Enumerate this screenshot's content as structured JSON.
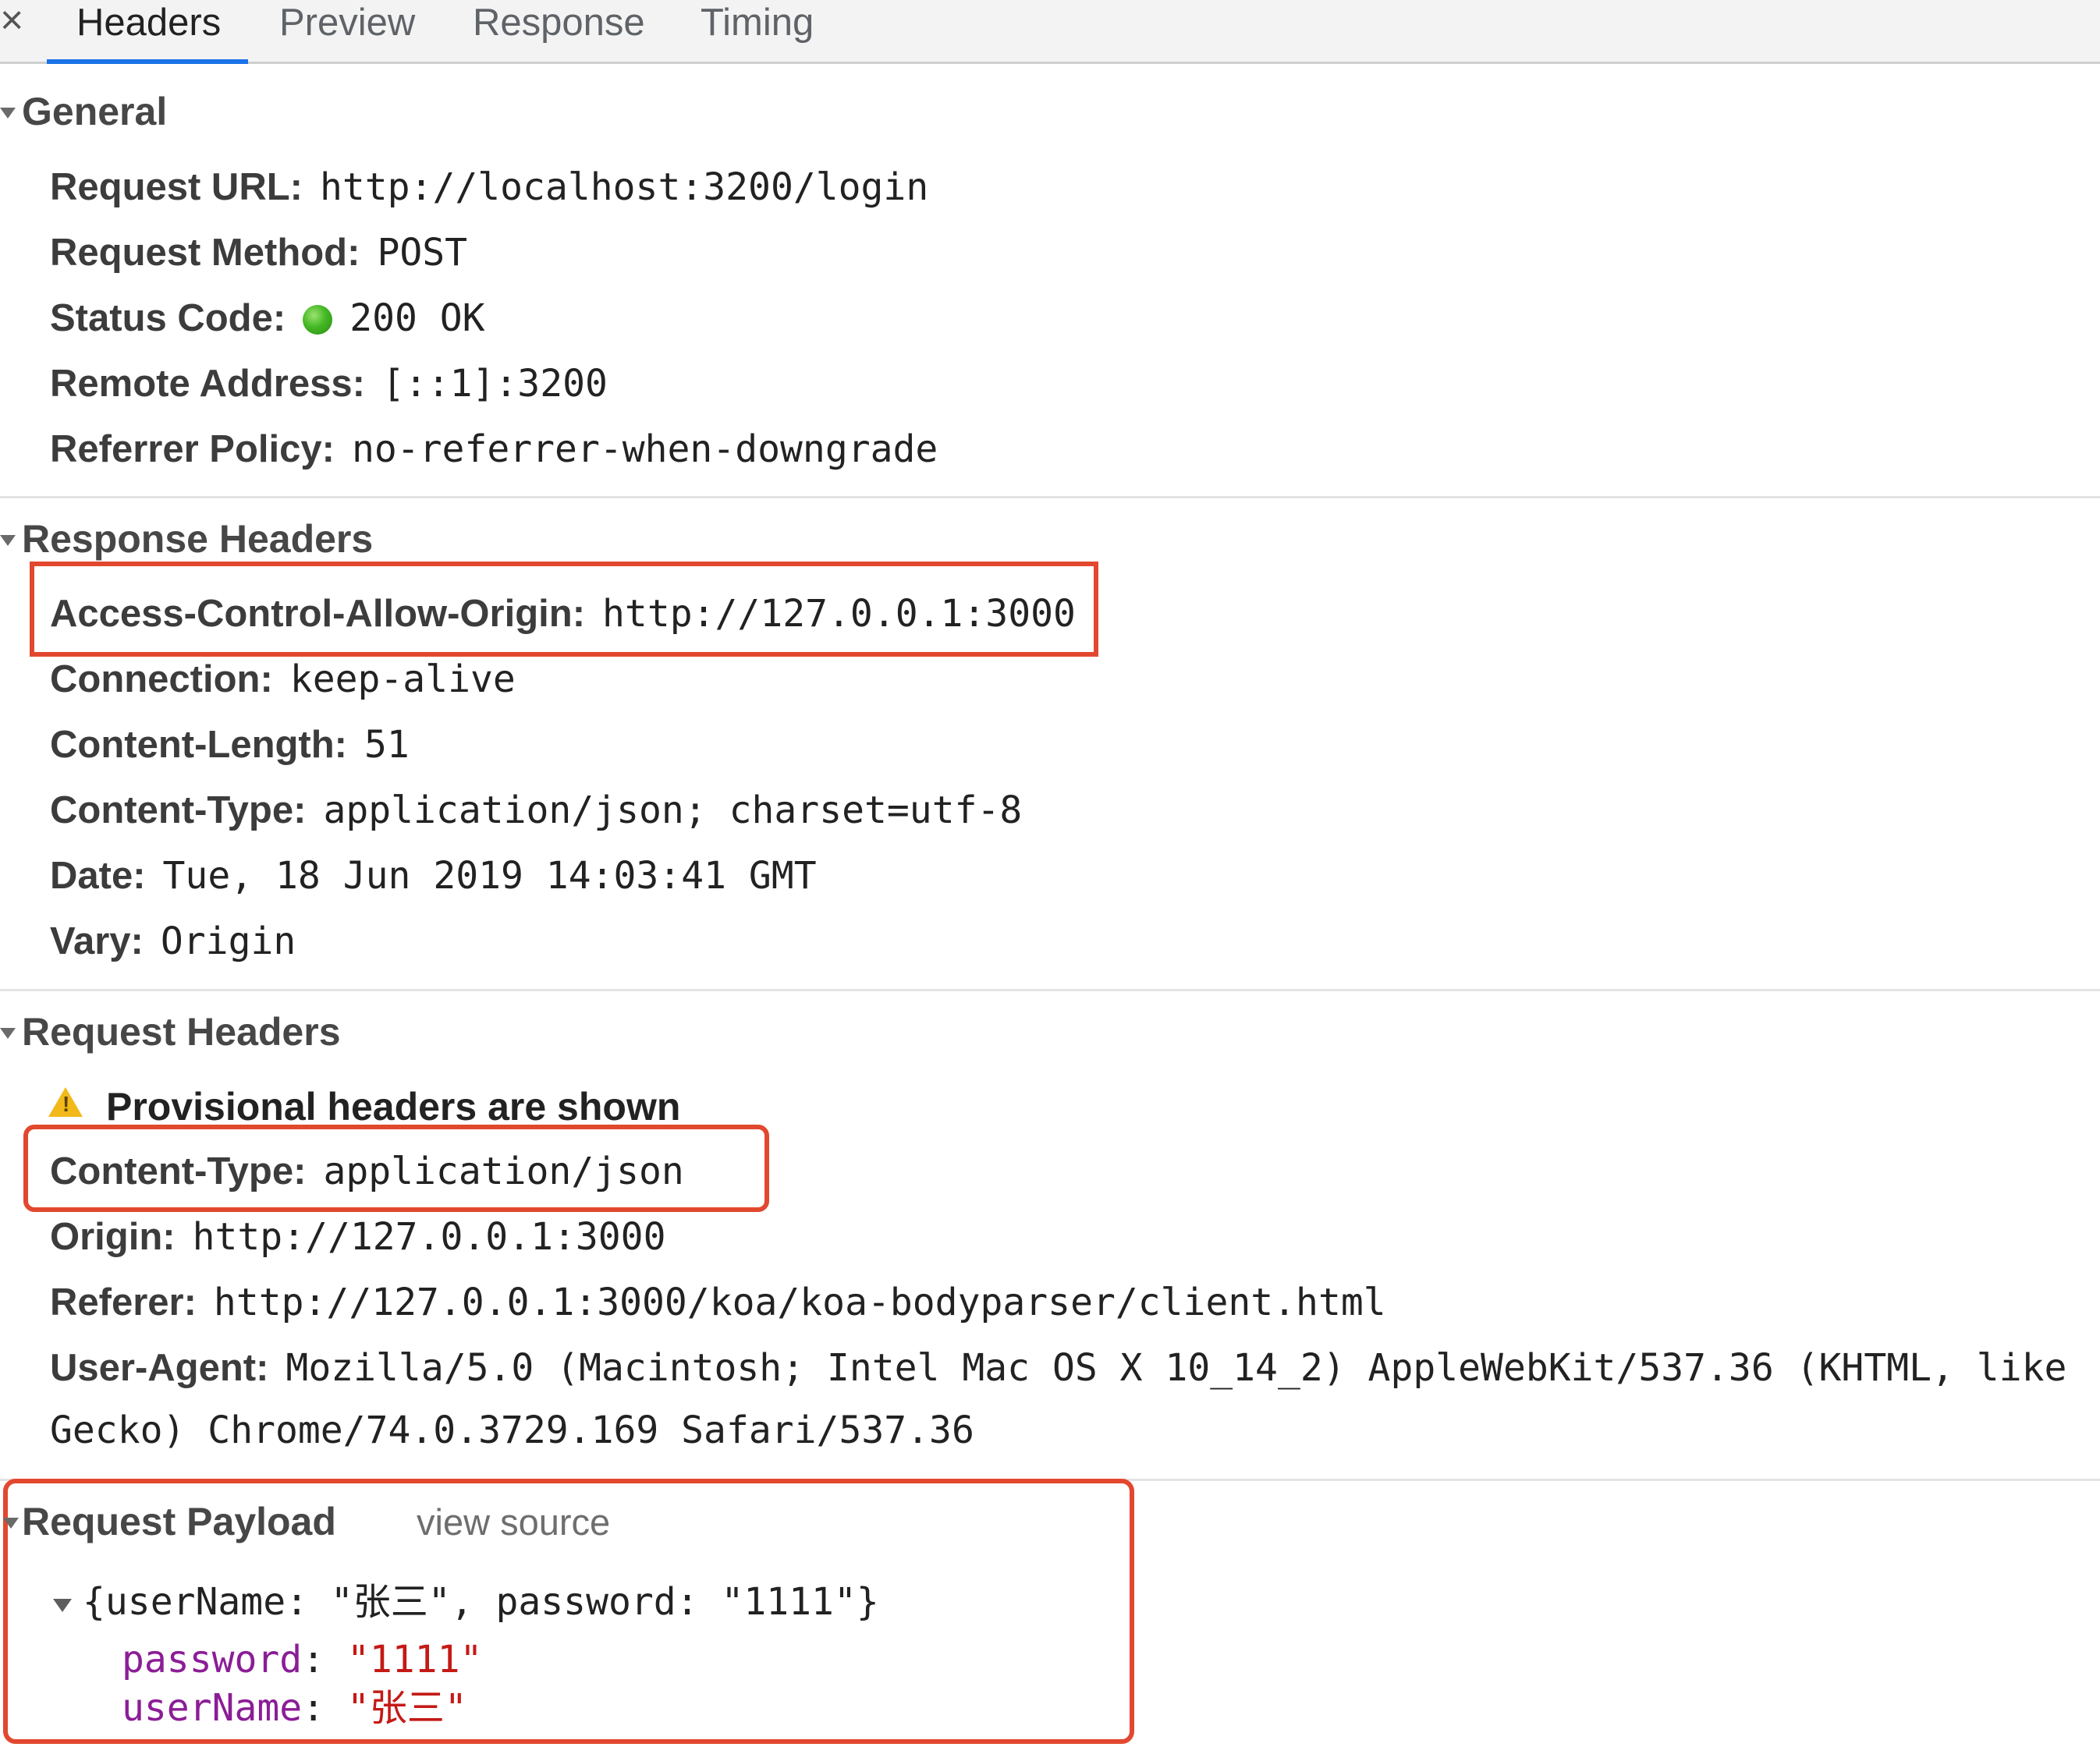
{
  "tabs": {
    "close_glyph": "×",
    "items": [
      "Headers",
      "Preview",
      "Response",
      "Timing"
    ],
    "active": "Headers"
  },
  "general": {
    "title": "General",
    "rows": [
      {
        "key": "Request URL:",
        "value": "http://localhost:3200/login"
      },
      {
        "key": "Request Method:",
        "value": "POST"
      },
      {
        "key": "Status Code:",
        "value": "200 OK"
      },
      {
        "key": "Remote Address:",
        "value": "[::1]:3200"
      },
      {
        "key": "Referrer Policy:",
        "value": "no-referrer-when-downgrade"
      }
    ]
  },
  "response_headers": {
    "title": "Response Headers",
    "rows": [
      {
        "key": "Access-Control-Allow-Origin:",
        "value": "http://127.0.0.1:3000"
      },
      {
        "key": "Connection:",
        "value": "keep-alive"
      },
      {
        "key": "Content-Length:",
        "value": "51"
      },
      {
        "key": "Content-Type:",
        "value": "application/json; charset=utf-8"
      },
      {
        "key": "Date:",
        "value": "Tue, 18 Jun 2019 14:03:41 GMT"
      },
      {
        "key": "Vary:",
        "value": "Origin"
      }
    ]
  },
  "request_headers": {
    "title": "Request Headers",
    "warning": "Provisional headers are shown",
    "rows": [
      {
        "key": "Content-Type:",
        "value": "application/json"
      },
      {
        "key": "Origin:",
        "value": "http://127.0.0.1:3000"
      },
      {
        "key": "Referer:",
        "value": "http://127.0.0.1:3000/koa/koa-bodyparser/client.html"
      },
      {
        "key": "User-Agent:",
        "value": "Mozilla/5.0 (Macintosh; Intel Mac OS X 10_14_2) AppleWebKit/537.36 (KHTML, like",
        "continuation": "Gecko) Chrome/74.0.3729.169 Safari/537.36"
      }
    ]
  },
  "request_payload": {
    "title": "Request Payload",
    "view_source": "view source",
    "summary": "{userName: \"张三\", password: \"1111\"}",
    "props": [
      {
        "key": "password",
        "value": "\"1111\""
      },
      {
        "key": "userName",
        "value": "\"张三\""
      }
    ]
  },
  "colors": {
    "highlight_box": "#e2482f",
    "tab_underline": "#1a73e8",
    "status_ok": "#44b824",
    "payload_key": "#8b1d96",
    "payload_string": "#c41a16"
  }
}
